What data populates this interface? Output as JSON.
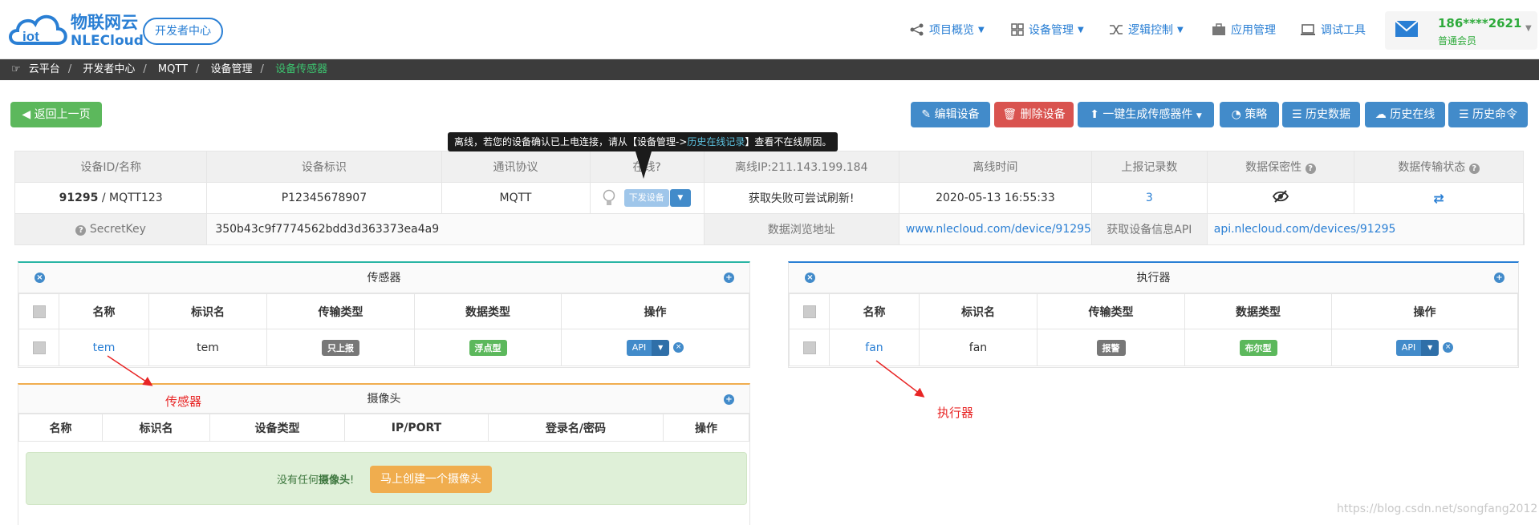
{
  "header": {
    "brand_cn": "物联网云",
    "brand_en": "NLECloud",
    "dev_center": "开发者中心",
    "nav": [
      "项目概览",
      "设备管理",
      "逻辑控制",
      "应用管理",
      "调试工具"
    ],
    "user_phone": "186****2621",
    "user_level": "普通会员"
  },
  "breadcrumb": [
    "云平台",
    "开发者中心",
    "MQTT",
    "设备管理",
    "设备传感器"
  ],
  "back_button": "返回上一页",
  "actions": [
    "编辑设备",
    "删除设备",
    "一键生成传感器件",
    "策略",
    "历史数据",
    "历史在线",
    "历史命令"
  ],
  "tooltip": {
    "before": "离线，若您的设备确认已上电连接，请从【设备管理->",
    "link": "历史在线记录",
    "after": "】查看不在线原因。"
  },
  "device": {
    "headers": [
      "设备ID/名称",
      "设备标识",
      "通讯协议",
      "在线?",
      "离线IP:211.143.199.184",
      "离线时间",
      "上报记录数",
      "数据保密性",
      "数据传输状态"
    ],
    "id": "91295",
    "name_rest": " / MQTT123",
    "tag": "P12345678907",
    "protocol": "MQTT",
    "issue_btn": "下发设备",
    "fetch_fail": "获取失败可尝试刷新!",
    "offline_time": "2020-05-13 16:55:33",
    "report_count": "3",
    "secret_label": "SecretKey",
    "secret_value": "350b43c9f7774562bdd3d363373ea4a9",
    "browse_label": "数据浏览地址",
    "browse_url": "www.nlecloud.com/device/91295",
    "api_label": "获取设备信息API",
    "api_url": "api.nlecloud.com/devices/91295"
  },
  "sensors": {
    "title": "传感器",
    "cols": [
      "名称",
      "标识名",
      "传输类型",
      "数据类型",
      "操作"
    ],
    "row": {
      "name": "tem",
      "ident": "tem",
      "transfer": "只上报",
      "dtype": "浮点型",
      "op": "API"
    }
  },
  "actuators": {
    "title": "执行器",
    "cols": [
      "名称",
      "标识名",
      "传输类型",
      "数据类型",
      "操作"
    ],
    "row": {
      "name": "fan",
      "ident": "fan",
      "transfer": "报警",
      "dtype": "布尔型",
      "op": "API"
    }
  },
  "cameras": {
    "title": "摄像头",
    "cols": [
      "名称",
      "标识名",
      "设备类型",
      "IP/PORT",
      "登录名/密码",
      "操作"
    ],
    "empty_pre": "没有任何",
    "empty_bold": "摄像头",
    "empty_post": "!",
    "create_btn": "马上创建一个摄像头"
  },
  "annotations": {
    "sensor": "传感器",
    "actuator": "执行器"
  },
  "watermark": "https://blog.csdn.net/songfang2012",
  "colors": {
    "brand": "#2a7fd4",
    "success": "#5cb85c",
    "danger": "#d9534f",
    "primary": "#428bca",
    "annotation": "#e82525"
  }
}
